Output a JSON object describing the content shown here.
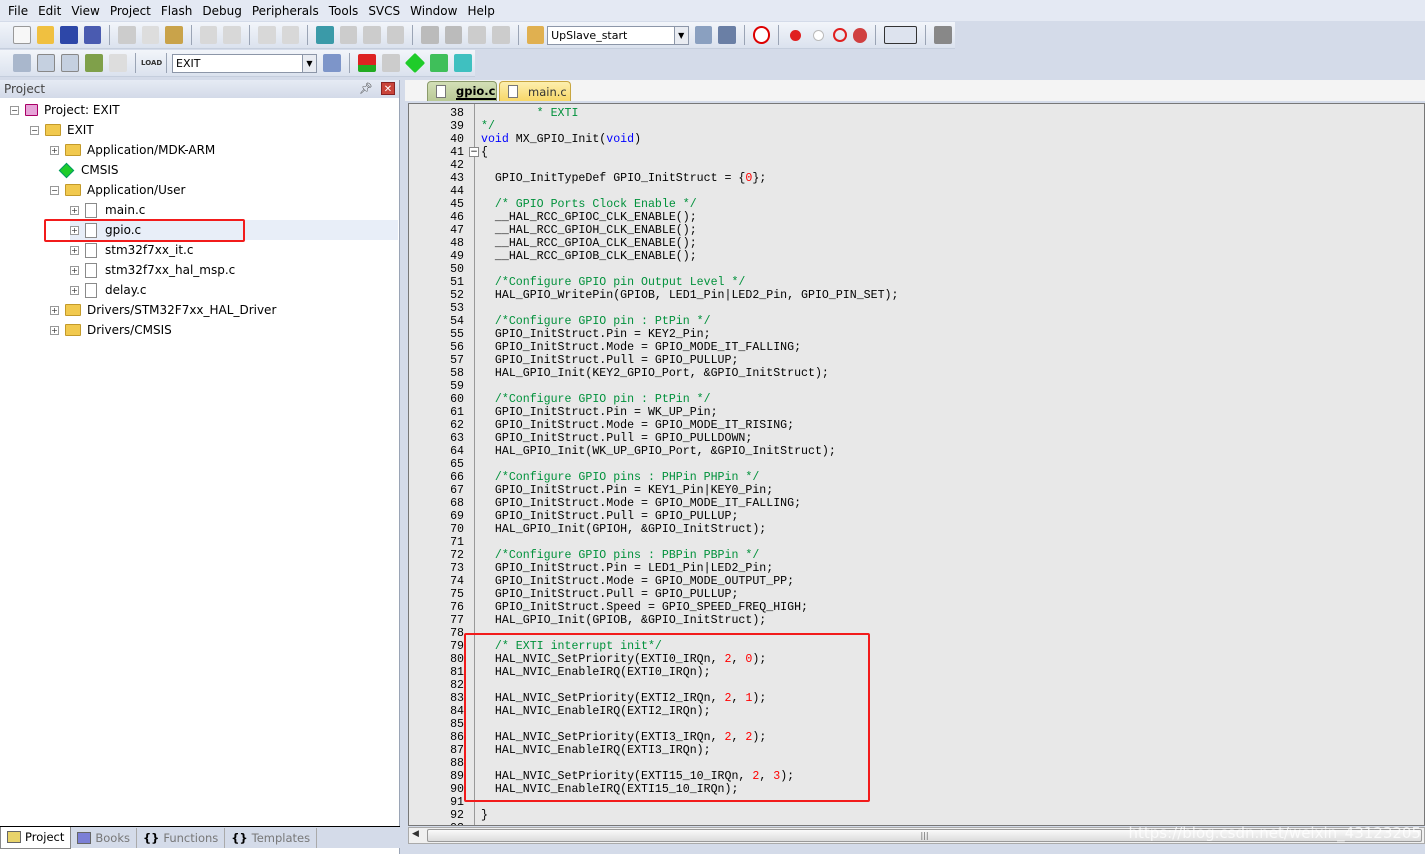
{
  "menu": [
    "File",
    "Edit",
    "View",
    "Project",
    "Flash",
    "Debug",
    "Peripherals",
    "Tools",
    "SVCS",
    "Window",
    "Help"
  ],
  "toolbar": {
    "find_combo_value": "UpSlave_start",
    "target_combo_value": "EXIT",
    "load_label": "LOAD"
  },
  "project_panel": {
    "title": "Project",
    "tree": [
      {
        "label": "Project: EXIT",
        "level": 0,
        "type": "project",
        "expander": "−"
      },
      {
        "label": "EXIT",
        "level": 1,
        "type": "target",
        "expander": "−"
      },
      {
        "label": "Application/MDK-ARM",
        "level": 2,
        "type": "folder",
        "expander": "+"
      },
      {
        "label": "CMSIS",
        "level": 2,
        "type": "cmsis",
        "expander": ""
      },
      {
        "label": "Application/User",
        "level": 2,
        "type": "folder",
        "expander": "−"
      },
      {
        "label": "main.c",
        "level": 3,
        "type": "file",
        "expander": "+"
      },
      {
        "label": "gpio.c",
        "level": 3,
        "type": "file",
        "expander": "+",
        "selected": true
      },
      {
        "label": "stm32f7xx_it.c",
        "level": 3,
        "type": "file",
        "expander": "+"
      },
      {
        "label": "stm32f7xx_hal_msp.c",
        "level": 3,
        "type": "file",
        "expander": "+"
      },
      {
        "label": "delay.c",
        "level": 3,
        "type": "file",
        "expander": "+"
      },
      {
        "label": "Drivers/STM32F7xx_HAL_Driver",
        "level": 2,
        "type": "folder",
        "expander": "+"
      },
      {
        "label": "Drivers/CMSIS",
        "level": 2,
        "type": "folder",
        "expander": "+"
      }
    ],
    "bottom_tabs": [
      {
        "label": "Project",
        "active": true,
        "icon": "project-icon"
      },
      {
        "label": "Books",
        "icon": "books-icon"
      },
      {
        "label": "Functions",
        "icon": "functions-icon",
        "glyph": "{}"
      },
      {
        "label": "Templates",
        "icon": "templates-icon",
        "glyph": "{}"
      }
    ]
  },
  "editor": {
    "tabs": [
      {
        "label": "gpio.c",
        "active": true
      },
      {
        "label": "main.c",
        "active": false
      }
    ],
    "lines": [
      {
        "n": "38",
        "tokens": [
          [
            "c",
            "        * EXTI"
          ]
        ]
      },
      {
        "n": "39",
        "tokens": [
          [
            "c",
            "*/"
          ]
        ]
      },
      {
        "n": "40",
        "tokens": [
          [
            "k",
            "void"
          ],
          [
            "t",
            " MX_GPIO_Init("
          ],
          [
            "k",
            "void"
          ],
          [
            "t",
            ")"
          ]
        ]
      },
      {
        "n": "41",
        "tokens": [
          [
            "t",
            "{"
          ]
        ]
      },
      {
        "n": "42",
        "tokens": []
      },
      {
        "n": "43",
        "tokens": [
          [
            "t",
            "  GPIO_InitTypeDef GPIO_InitStruct = {"
          ],
          [
            "n",
            "0"
          ],
          [
            "t",
            "};"
          ]
        ]
      },
      {
        "n": "44",
        "tokens": []
      },
      {
        "n": "45",
        "tokens": [
          [
            "c",
            "  /* GPIO Ports Clock Enable */"
          ]
        ]
      },
      {
        "n": "46",
        "tokens": [
          [
            "t",
            "  __HAL_RCC_GPIOC_CLK_ENABLE();"
          ]
        ]
      },
      {
        "n": "47",
        "tokens": [
          [
            "t",
            "  __HAL_RCC_GPIOH_CLK_ENABLE();"
          ]
        ]
      },
      {
        "n": "48",
        "tokens": [
          [
            "t",
            "  __HAL_RCC_GPIOA_CLK_ENABLE();"
          ]
        ]
      },
      {
        "n": "49",
        "tokens": [
          [
            "t",
            "  __HAL_RCC_GPIOB_CLK_ENABLE();"
          ]
        ]
      },
      {
        "n": "50",
        "tokens": []
      },
      {
        "n": "51",
        "tokens": [
          [
            "c",
            "  /*Configure GPIO pin Output Level */"
          ]
        ]
      },
      {
        "n": "52",
        "tokens": [
          [
            "t",
            "  HAL_GPIO_WritePin(GPIOB, LED1_Pin|LED2_Pin, GPIO_PIN_SET);"
          ]
        ]
      },
      {
        "n": "53",
        "tokens": []
      },
      {
        "n": "54",
        "tokens": [
          [
            "c",
            "  /*Configure GPIO pin : PtPin */"
          ]
        ]
      },
      {
        "n": "55",
        "tokens": [
          [
            "t",
            "  GPIO_InitStruct.Pin = KEY2_Pin;"
          ]
        ]
      },
      {
        "n": "56",
        "tokens": [
          [
            "t",
            "  GPIO_InitStruct.Mode = GPIO_MODE_IT_FALLING;"
          ]
        ]
      },
      {
        "n": "57",
        "tokens": [
          [
            "t",
            "  GPIO_InitStruct.Pull = GPIO_PULLUP;"
          ]
        ]
      },
      {
        "n": "58",
        "tokens": [
          [
            "t",
            "  HAL_GPIO_Init(KEY2_GPIO_Port, &GPIO_InitStruct);"
          ]
        ]
      },
      {
        "n": "59",
        "tokens": []
      },
      {
        "n": "60",
        "tokens": [
          [
            "c",
            "  /*Configure GPIO pin : PtPin */"
          ]
        ]
      },
      {
        "n": "61",
        "tokens": [
          [
            "t",
            "  GPIO_InitStruct.Pin = WK_UP_Pin;"
          ]
        ]
      },
      {
        "n": "62",
        "tokens": [
          [
            "t",
            "  GPIO_InitStruct.Mode = GPIO_MODE_IT_RISING;"
          ]
        ]
      },
      {
        "n": "63",
        "tokens": [
          [
            "t",
            "  GPIO_InitStruct.Pull = GPIO_PULLDOWN;"
          ]
        ]
      },
      {
        "n": "64",
        "tokens": [
          [
            "t",
            "  HAL_GPIO_Init(WK_UP_GPIO_Port, &GPIO_InitStruct);"
          ]
        ]
      },
      {
        "n": "65",
        "tokens": []
      },
      {
        "n": "66",
        "tokens": [
          [
            "c",
            "  /*Configure GPIO pins : PHPin PHPin */"
          ]
        ]
      },
      {
        "n": "67",
        "tokens": [
          [
            "t",
            "  GPIO_InitStruct.Pin = KEY1_Pin|KEY0_Pin;"
          ]
        ]
      },
      {
        "n": "68",
        "tokens": [
          [
            "t",
            "  GPIO_InitStruct.Mode = GPIO_MODE_IT_FALLING;"
          ]
        ]
      },
      {
        "n": "69",
        "tokens": [
          [
            "t",
            "  GPIO_InitStruct.Pull = GPIO_PULLUP;"
          ]
        ]
      },
      {
        "n": "70",
        "tokens": [
          [
            "t",
            "  HAL_GPIO_Init(GPIOH, &GPIO_InitStruct);"
          ]
        ]
      },
      {
        "n": "71",
        "tokens": []
      },
      {
        "n": "72",
        "tokens": [
          [
            "c",
            "  /*Configure GPIO pins : PBPin PBPin */"
          ]
        ]
      },
      {
        "n": "73",
        "tokens": [
          [
            "t",
            "  GPIO_InitStruct.Pin = LED1_Pin|LED2_Pin;"
          ]
        ]
      },
      {
        "n": "74",
        "tokens": [
          [
            "t",
            "  GPIO_InitStruct.Mode = GPIO_MODE_OUTPUT_PP;"
          ]
        ]
      },
      {
        "n": "75",
        "tokens": [
          [
            "t",
            "  GPIO_InitStruct.Pull = GPIO_PULLUP;"
          ]
        ]
      },
      {
        "n": "76",
        "tokens": [
          [
            "t",
            "  GPIO_InitStruct.Speed = GPIO_SPEED_FREQ_HIGH;"
          ]
        ]
      },
      {
        "n": "77",
        "tokens": [
          [
            "t",
            "  HAL_GPIO_Init(GPIOB, &GPIO_InitStruct);"
          ]
        ]
      },
      {
        "n": "78",
        "tokens": []
      },
      {
        "n": "79",
        "tokens": [
          [
            "c",
            "  /* EXTI interrupt init*/"
          ]
        ]
      },
      {
        "n": "80",
        "tokens": [
          [
            "t",
            "  HAL_NVIC_SetPriority(EXTI0_IRQn, "
          ],
          [
            "n",
            "2"
          ],
          [
            "t",
            ", "
          ],
          [
            "n",
            "0"
          ],
          [
            "t",
            ");"
          ]
        ]
      },
      {
        "n": "81",
        "tokens": [
          [
            "t",
            "  HAL_NVIC_EnableIRQ(EXTI0_IRQn);"
          ]
        ]
      },
      {
        "n": "82",
        "tokens": []
      },
      {
        "n": "83",
        "tokens": [
          [
            "t",
            "  HAL_NVIC_SetPriority(EXTI2_IRQn, "
          ],
          [
            "n",
            "2"
          ],
          [
            "t",
            ", "
          ],
          [
            "n",
            "1"
          ],
          [
            "t",
            ");"
          ]
        ]
      },
      {
        "n": "84",
        "tokens": [
          [
            "t",
            "  HAL_NVIC_EnableIRQ(EXTI2_IRQn);"
          ]
        ]
      },
      {
        "n": "85",
        "tokens": []
      },
      {
        "n": "86",
        "tokens": [
          [
            "t",
            "  HAL_NVIC_SetPriority(EXTI3_IRQn, "
          ],
          [
            "n",
            "2"
          ],
          [
            "t",
            ", "
          ],
          [
            "n",
            "2"
          ],
          [
            "t",
            ");"
          ]
        ]
      },
      {
        "n": "87",
        "tokens": [
          [
            "t",
            "  HAL_NVIC_EnableIRQ(EXTI3_IRQn);"
          ]
        ]
      },
      {
        "n": "88",
        "tokens": []
      },
      {
        "n": "89",
        "tokens": [
          [
            "t",
            "  HAL_NVIC_SetPriority(EXTI15_10_IRQn, "
          ],
          [
            "n",
            "2"
          ],
          [
            "t",
            ", "
          ],
          [
            "n",
            "3"
          ],
          [
            "t",
            ");"
          ]
        ]
      },
      {
        "n": "90",
        "tokens": [
          [
            "t",
            "  HAL_NVIC_EnableIRQ(EXTI15_10_IRQn);"
          ]
        ]
      },
      {
        "n": "91",
        "tokens": []
      },
      {
        "n": "92",
        "tokens": [
          [
            "t",
            "}"
          ]
        ]
      },
      {
        "n": "93",
        "tokens": []
      }
    ]
  },
  "watermark": "https://blog.csdn.net/weixin_43123205",
  "colors": {
    "comment": "#00913b",
    "keyword": "#0000ff",
    "number": "#ff0000",
    "highlight_box": "#f21b1b",
    "active_tab": "#c5d3a6",
    "inactive_tab": "#fbe38b"
  }
}
